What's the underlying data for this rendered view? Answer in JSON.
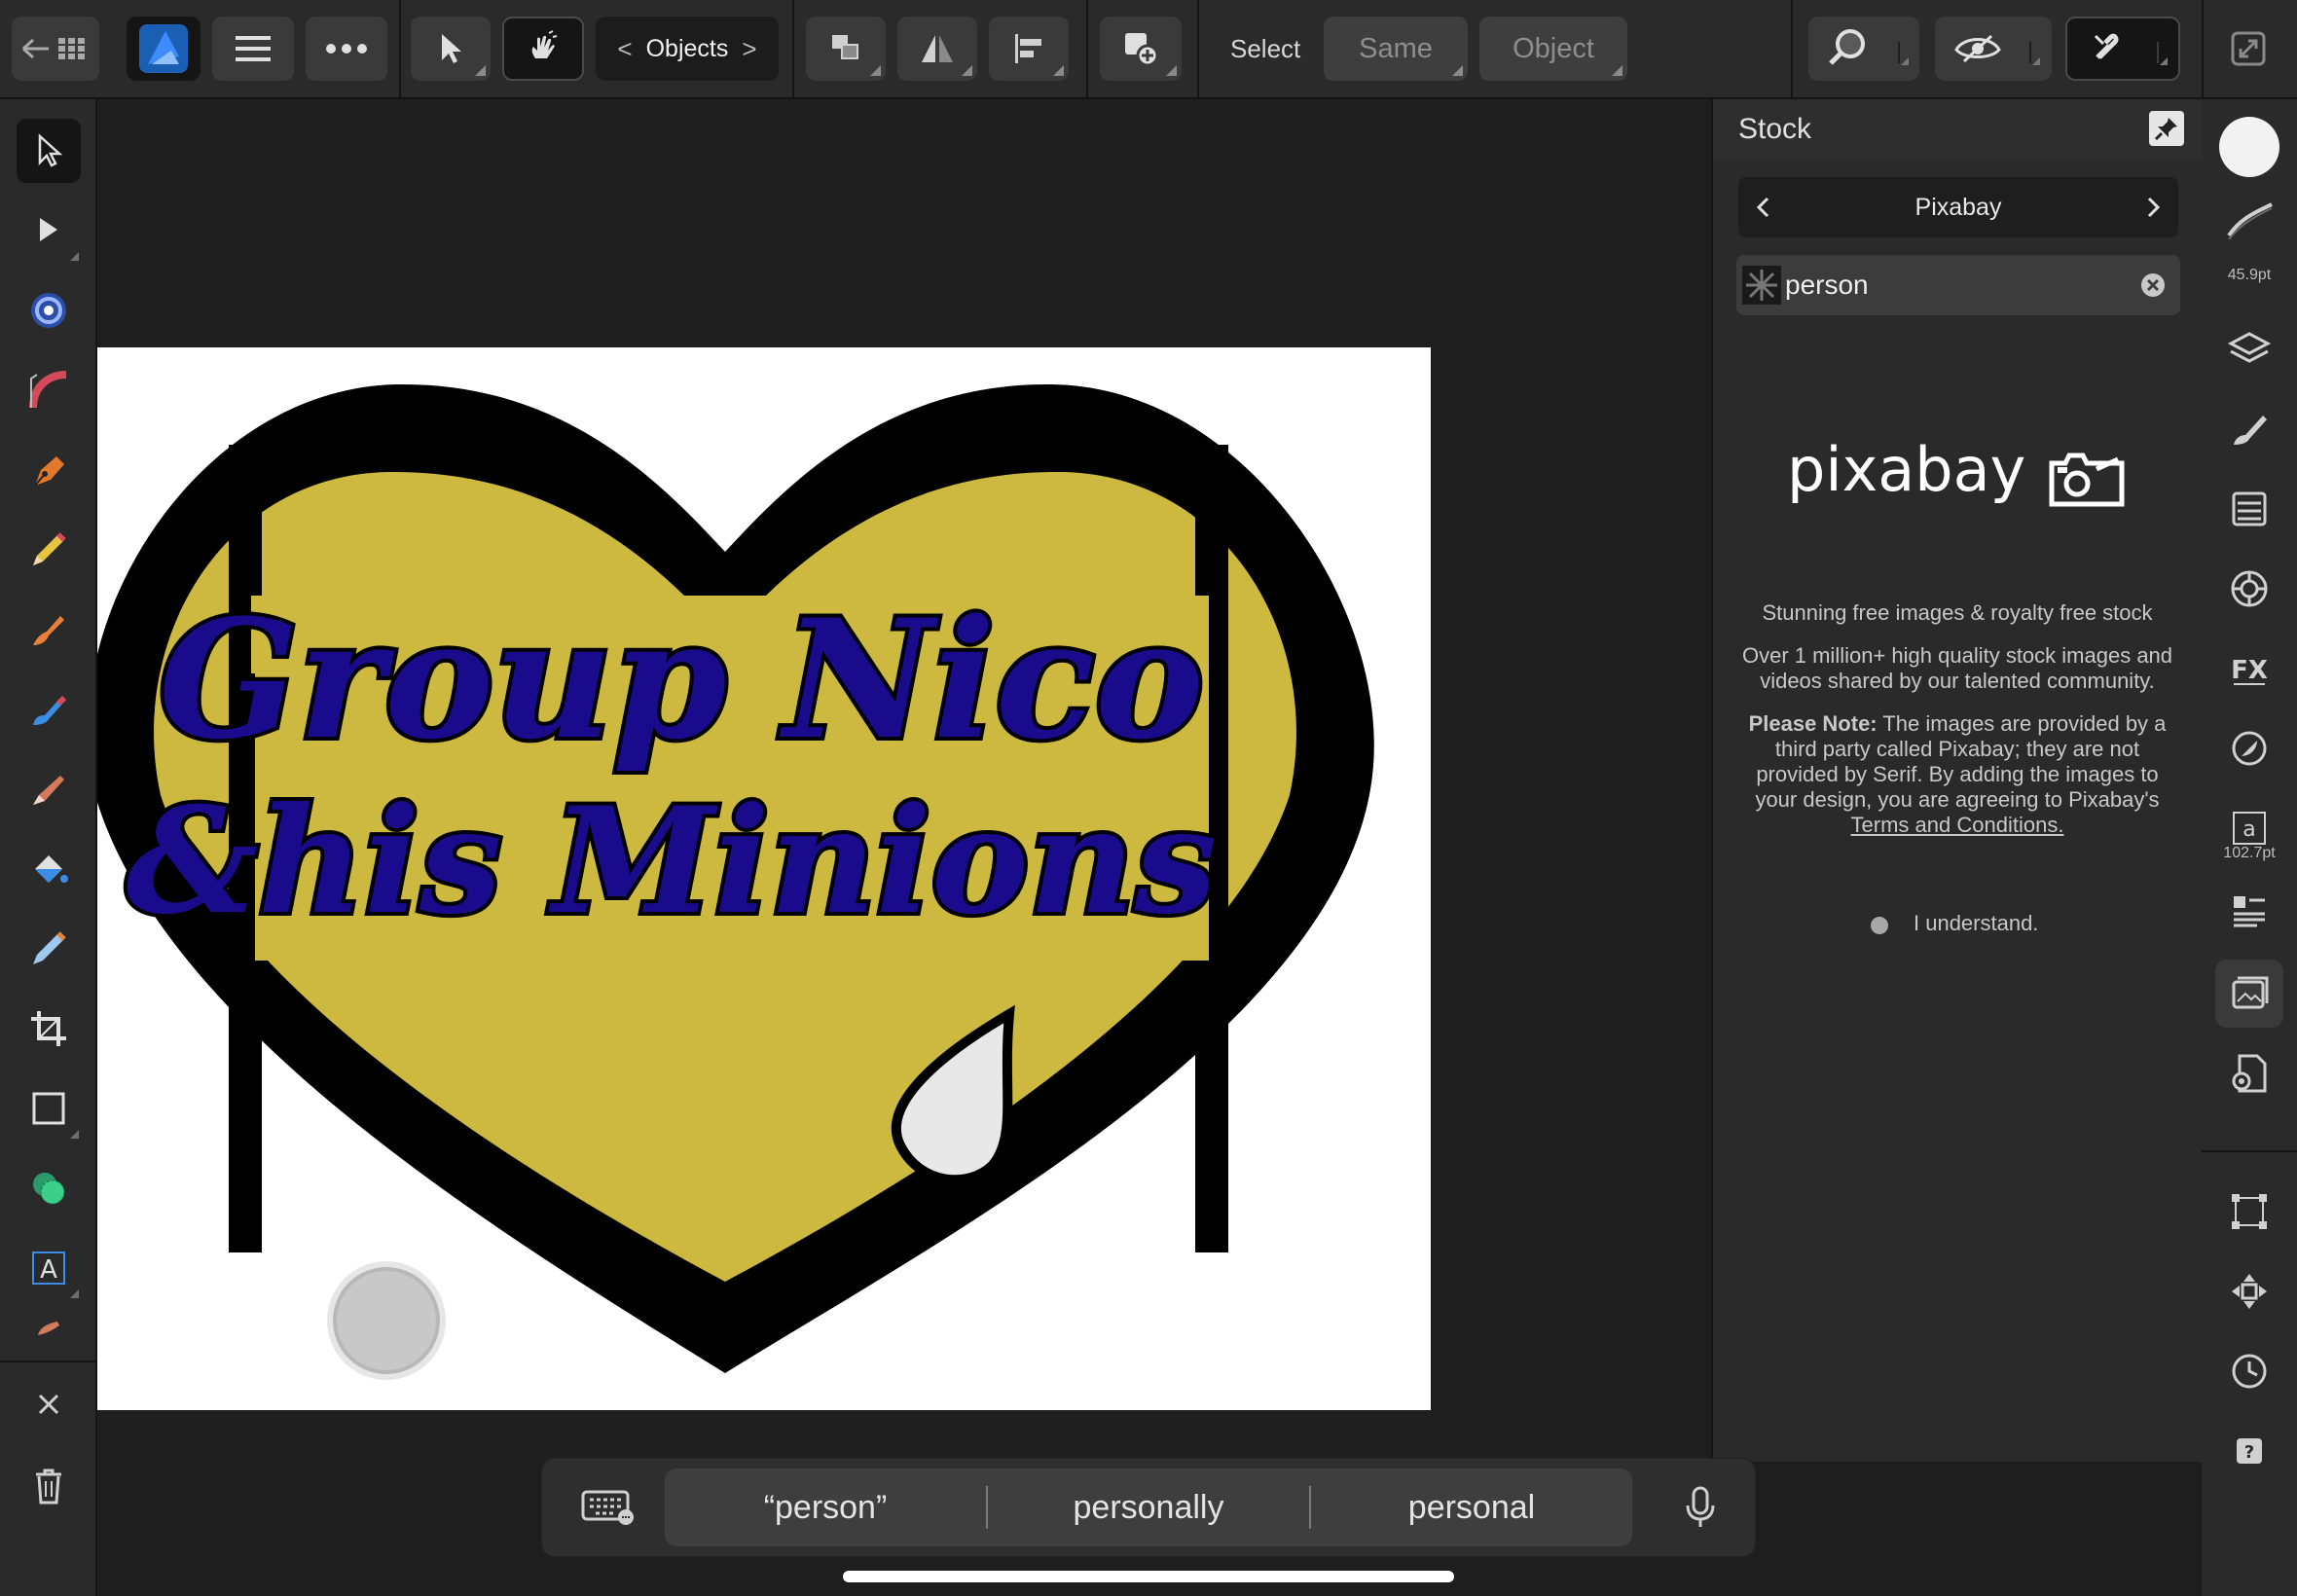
{
  "toolbar": {
    "objects_label": "Objects",
    "select_label": "Select",
    "same_label": "Same",
    "object_label": "Object"
  },
  "canvas": {
    "line1": "Group Nico",
    "line2": "&his Minions"
  },
  "stock": {
    "title": "Stock",
    "provider": "Pixabay",
    "search_value": "person",
    "logo_text": "pixabay",
    "tagline": "Stunning free images & royalty free stock",
    "description": "Over 1 million+ high quality stock images and videos shared by our talented community.",
    "note_label": "Please Note:",
    "note_text": "The images are provided by a third party called Pixabay; they are not provided by Serif. By adding the images to your design, you are agreeing to Pixabay's",
    "terms_link": "Terms and Conditions.",
    "understand_label": "I understand."
  },
  "right_strip": {
    "brush_size": "45.9pt",
    "font_size": "102.7pt"
  },
  "suggestions": [
    "“person”",
    "personally",
    "personal"
  ],
  "colors": {
    "heart_fill": "#cdb940",
    "heart_stroke": "#000000",
    "text_fill": "#1a0a8c",
    "app_bg": "#1e1e1e",
    "panel_bg": "#2a2a2a",
    "accent_blue": "#3d8bff"
  },
  "icons": {
    "back": "back-grid-icon",
    "app": "affinity-designer-icon",
    "menu": "hamburger-icon",
    "more": "more-icon",
    "pin": "pin-icon",
    "mic": "microphone-icon",
    "keyboard": "keyboard-icon"
  }
}
